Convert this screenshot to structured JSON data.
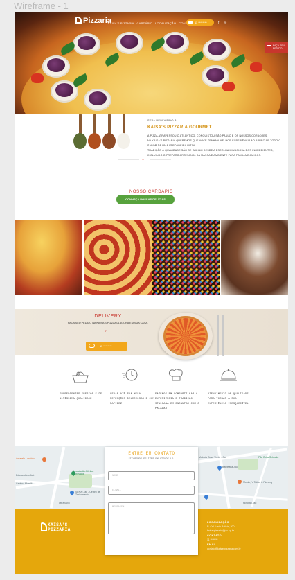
{
  "canvas": {
    "title": "Wireframe - 1"
  },
  "header": {
    "logo": "Pizzaria",
    "nav": [
      "KAISA'S PIZZARIA",
      "CARDÁPIO",
      "LOCALIZAÇÃO",
      "CONTATO"
    ],
    "phone": "11 ********",
    "social": [
      "facebook-icon",
      "instagram-icon"
    ],
    "order_badge": "FAÇA SEU PEDIDO"
  },
  "welcome": {
    "kicker": "SEJA BEM-VINDO A",
    "title": "KAISA'S PIZZARIA GOURMET",
    "paragraphs": [
      "A PIZZA ATRAVESSOU O ATLÂNTICO, CONQUISTOU SÃO PAULO E OS NOSSOS CORAÇÕES.",
      "NA KAISA'S PIZZARIA QUEREMOS QUE VOCÊ TENHA A MELHOR EXPERIÊNCIA AO APRECIAR TODO O SABOR DE UMA VERDADEIRA PIZZA.",
      "TRADIÇÃO & QUALIDADE SÃO SE INICIAM DESDE A ESCOLHA MINUCIOSA DOS INGREDIENTES, INCLUINDO O PREPARO ARTESANAL DA MASSA E AMBIENTE PARA FAMÍLIA E AMIGOS."
    ]
  },
  "menu": {
    "title": "NOSSO CARDÁPIO",
    "button": "CONHEÇA NOSSAS DELÍCIAS"
  },
  "delivery": {
    "title": "DELIVERY",
    "subtitle": "FAÇA SEU PEDIDO NA KAISA'S PIZZARIA AGORA EM SUA CASA.",
    "phone": "11 ********"
  },
  "features": [
    {
      "icon": "basket-icon",
      "text": "INGREDIENTES FRESCOS E DE ALTÍSSIMA QUALIDADE"
    },
    {
      "icon": "delivery-icon",
      "text": "LEVAR ATÉ SUA MESA REFEIÇÕES DELICIOSAS E COM RAPIDEZ"
    },
    {
      "icon": "chef-hat-icon",
      "text": "FAZEMOS EM COMPARTILHAR A EXPERIÊNCIA E TRADIÇÃO ITALIANA EM ENCANTAR COM O PALADAR"
    },
    {
      "icon": "cloche-icon",
      "text": "ATENDIMENTO DE QUALIDADE PARA TORNAR A SUA EXPERIÊNCIA INESQUECÍVEL"
    }
  ],
  "map": {
    "labels": [
      "Amarelo Lanchão",
      "Educandário Jaú",
      "Cantina Morelli",
      "Associação Atlética Ferroviária",
      "SENAI Jaú - Centro de Treinamento",
      "Ultrabaixo",
      "Moldeis Casa Verde - Jaú",
      "Barbearia Jaú",
      "Pão Bella Sebrada",
      "Monkey's Tattoo & Piercing",
      "Hospital Jaú"
    ]
  },
  "contact": {
    "title": "ENTRE EM CONTATO",
    "subtitle": "FICAREMOS FELIZES EM ATENDÊ-LO.",
    "fields": [
      "NOME",
      "E-MAIL",
      "MENSAGEM"
    ]
  },
  "footer": {
    "logo_line1": "KAISA'S",
    "logo_line2": "PIZZARIA",
    "info": [
      {
        "label": "LOCALIZAÇÃO",
        "value": "R. Cel. Lúcio Batista, 300"
      },
      {
        "label": "",
        "value": "kaisaspizzaria@jau.sp.br"
      },
      {
        "label": "CONTATO",
        "value": "11 ********"
      },
      {
        "label": "EMAIL",
        "value": "contato@kaisaspizzaria.com.br"
      }
    ]
  },
  "colors": {
    "accent": "#e5a70c",
    "brand_red": "#c8362d",
    "green": "#57a23d"
  }
}
